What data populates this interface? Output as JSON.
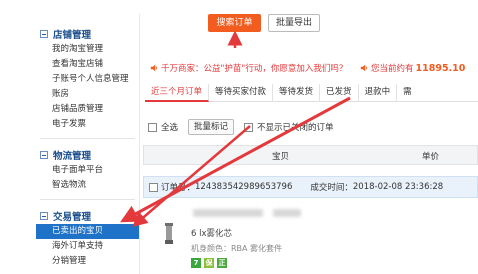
{
  "sidebar": {
    "sections": [
      {
        "title": "店铺管理",
        "items": [
          "我的淘宝管理",
          "查看淘宝店铺",
          "子账号个人信息管理",
          "账房",
          "店铺品质管理",
          "电子发票"
        ]
      },
      {
        "title": "物流管理",
        "items": [
          "电子面单平台",
          "智选物流"
        ]
      },
      {
        "title": "交易管理",
        "items": [
          "已卖出的宝贝",
          "海外订单支持",
          "分销管理"
        ]
      }
    ],
    "active_item": "已卖出的宝贝"
  },
  "toolbar_top": {
    "search_label": "搜索订单",
    "export_label": "批量导出"
  },
  "notice": {
    "left_text": "千万商家：公益\"护苗\"行动，你愿意加入我们吗？",
    "right_prefix": "您当前约有",
    "right_number": "11895.10"
  },
  "tabs": [
    "近三个月订单",
    "等待买家付款",
    "等待发货",
    "已发货",
    "退款中",
    "需"
  ],
  "list_toolbar": {
    "select_all": "全选",
    "batch_mark": "批量标记",
    "hide_closed": "不显示已关闭的订单"
  },
  "table_header": {
    "item": "宝贝",
    "price": "单价"
  },
  "order": {
    "number_label": "订单号：",
    "number": "124383542989653796",
    "time_label": "成交时间：",
    "time": "2018-02-08 23:36:28"
  },
  "item": {
    "title": "6 lx雾化芯",
    "attr": "机身颜色：RBA 雾化套件"
  },
  "colors": {
    "accent": "#f25c1f",
    "active_nav": "#1e73c8",
    "arrow": "#e4393c"
  },
  "badges": [
    {
      "icon": "seven-day-icon",
      "label": "7",
      "color": "#3aa640"
    },
    {
      "icon": "guarantee-icon",
      "label": "保",
      "color": "#8bbf3a"
    },
    {
      "icon": "genuine-icon",
      "label": "正",
      "color": "#4aa83c"
    }
  ]
}
